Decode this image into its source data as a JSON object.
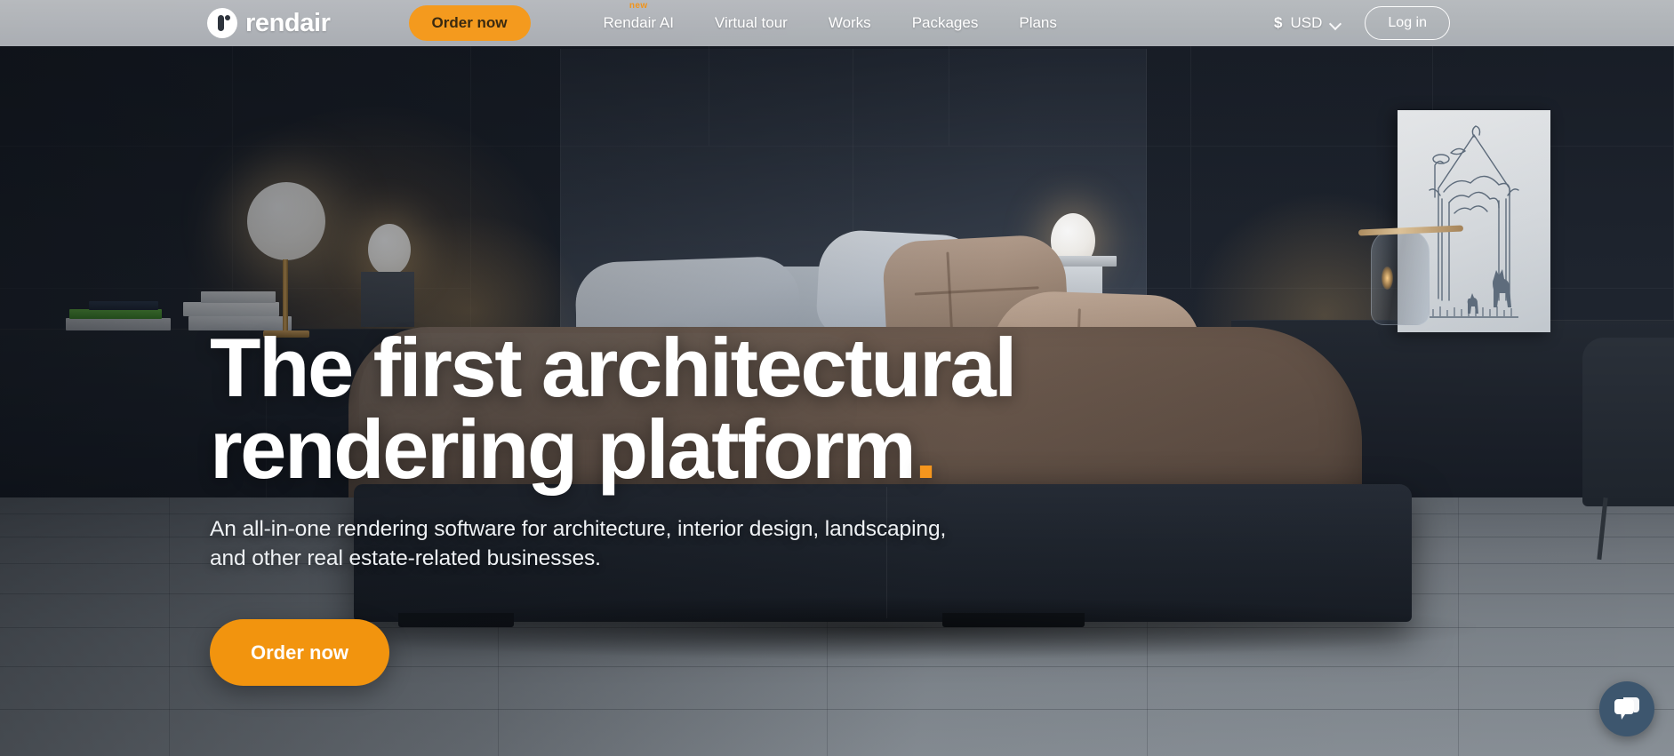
{
  "header": {
    "brand": {
      "name": "rendair",
      "logo_icon": "rendair-logo-icon"
    },
    "cta_label": "Order now",
    "nav_items": [
      {
        "label": "Rendair AI",
        "badge": "new"
      },
      {
        "label": "Virtual tour",
        "badge": ""
      },
      {
        "label": "Works",
        "badge": ""
      },
      {
        "label": "Packages",
        "badge": ""
      },
      {
        "label": "Plans",
        "badge": ""
      }
    ],
    "currency": {
      "symbol": "$",
      "code": "USD",
      "chevron_icon": "chevron-down-icon"
    },
    "login_label": "Log in"
  },
  "hero": {
    "title_line1": "The first architectural",
    "title_line2": "rendering platform",
    "title_period": ".",
    "subtitle_line1": "An all-in-one rendering software for architecture, interior design, landscaping,",
    "subtitle_line2": "and other real estate-related businesses.",
    "cta_label": "Order now",
    "background_description": "Dark modern bedroom interior render with upholstered wall panels, two glowing bedside lamps, a bed with brown and white bedding, framed line-art of a tree arch with deer, and gray wood plank flooring"
  },
  "chat": {
    "icon": "chat-bubble-icon",
    "aria_label": "Open chat"
  },
  "colors": {
    "accent_orange": "#f2940e",
    "nav_bar": "#bcc0c5",
    "chat_blue": "#3d566e",
    "hero_text": "#ffffff",
    "wall_dark": "#1b2029",
    "floor_gray": "#7c838a"
  }
}
